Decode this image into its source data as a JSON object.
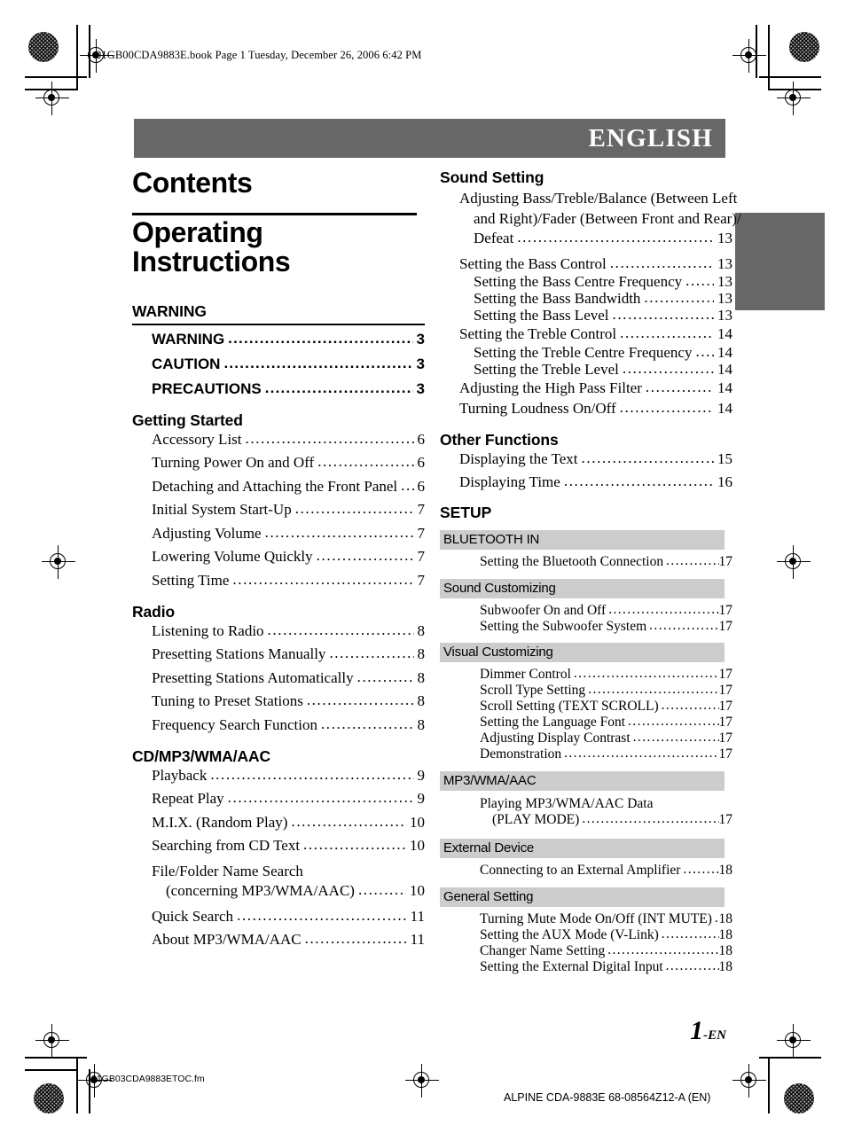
{
  "print_marks": {
    "file_info_line": "01GB00CDA9883E.book  Page 1  Tuesday, December 26, 2006  6:42 PM",
    "footer_filename": "01GB03CDA9883ETOC.fm",
    "footer_model": "ALPINE CDA-9883E 68-08564Z12-A (EN)"
  },
  "banner": {
    "language": "ENGLISH",
    "bar_color": "#676767",
    "text_color": "#ffffff"
  },
  "thumb_tab": {
    "color": "#676767"
  },
  "titles": {
    "contents": "Contents",
    "operating_instructions": "Operating Instructions"
  },
  "page_number": {
    "number": "1",
    "suffix": "-EN"
  },
  "left_column": {
    "sections": [
      {
        "heading": "WARNING",
        "ruled": true,
        "bold_entries": true,
        "entries": [
          {
            "label": "WARNING",
            "page": "3"
          },
          {
            "label": "CAUTION",
            "page": "3"
          },
          {
            "label": "PRECAUTIONS",
            "page": "3"
          }
        ]
      },
      {
        "heading": "Getting Started",
        "ruled": false,
        "bold_entries": false,
        "entries": [
          {
            "label": "Accessory List",
            "page": "6"
          },
          {
            "label": "Turning Power On and Off",
            "page": "6"
          },
          {
            "label": "Detaching and Attaching the Front Panel",
            "page": "6"
          },
          {
            "label": "Initial System Start-Up",
            "page": "7"
          },
          {
            "label": "Adjusting Volume",
            "page": "7"
          },
          {
            "label": "Lowering Volume Quickly",
            "page": "7"
          },
          {
            "label": "Setting Time",
            "page": "7"
          }
        ]
      },
      {
        "heading": "Radio",
        "ruled": false,
        "bold_entries": false,
        "entries": [
          {
            "label": "Listening to Radio",
            "page": "8"
          },
          {
            "label": "Presetting Stations Manually",
            "page": "8"
          },
          {
            "label": "Presetting Stations Automatically",
            "page": "8"
          },
          {
            "label": "Tuning to Preset Stations",
            "page": "8"
          },
          {
            "label": "Frequency Search Function",
            "page": "8"
          }
        ]
      },
      {
        "heading": "CD/MP3/WMA/AAC",
        "ruled": false,
        "bold_entries": false,
        "entries": [
          {
            "label": "Playback",
            "page": "9"
          },
          {
            "label": "Repeat Play",
            "page": "9"
          },
          {
            "label": "M.I.X. (Random Play)",
            "page": "10"
          },
          {
            "label": "Searching from CD Text",
            "page": "10"
          }
        ],
        "wrapped_entry": {
          "line1": "File/Folder Name Search",
          "line2": "(concerning MP3/WMA/AAC)",
          "page": "10"
        },
        "entries_after": [
          {
            "label": "Quick Search",
            "page": "11"
          },
          {
            "label": "About MP3/WMA/AAC",
            "page": "11"
          }
        ]
      }
    ]
  },
  "right_column": {
    "sound_setting": {
      "heading": "Sound Setting",
      "wrapped_entry": {
        "line1": "Adjusting Bass/Treble/Balance (Between Left",
        "line2": "and Right)/Fader (Between Front and Rear)/",
        "line3": "Defeat",
        "page": "13"
      },
      "entries": [
        {
          "label": "Setting the Bass Control",
          "page": "13",
          "sub": false
        },
        {
          "label": "Setting the Bass Centre Frequency",
          "page": "13",
          "sub": true
        },
        {
          "label": "Setting the Bass Bandwidth",
          "page": "13",
          "sub": true
        },
        {
          "label": "Setting the Bass Level",
          "page": "13",
          "sub": true
        },
        {
          "label": "Setting the Treble Control",
          "page": "14",
          "sub": false
        },
        {
          "label": "Setting the Treble Centre Frequency",
          "page": "14",
          "sub": true
        },
        {
          "label": "Setting the Treble Level",
          "page": "14",
          "sub": true
        },
        {
          "label": "Adjusting the High Pass Filter",
          "page": "14",
          "sub": false
        },
        {
          "label": "Turning Loudness On/Off",
          "page": "14",
          "sub": false
        }
      ]
    },
    "other_functions": {
      "heading": "Other Functions",
      "entries": [
        {
          "label": "Displaying the Text",
          "page": "15"
        },
        {
          "label": "Displaying Time",
          "page": "16"
        }
      ]
    },
    "setup": {
      "heading": "SETUP",
      "blocks": [
        {
          "title": "BLUETOOTH IN",
          "entries": [
            {
              "label": "Setting the Bluetooth Connection",
              "page": "17"
            }
          ]
        },
        {
          "title": "Sound Customizing",
          "entries": [
            {
              "label": "Subwoofer On and Off",
              "page": "17"
            },
            {
              "label": "Setting the Subwoofer System",
              "page": "17"
            }
          ]
        },
        {
          "title": "Visual Customizing",
          "entries": [
            {
              "label": "Dimmer Control",
              "page": "17"
            },
            {
              "label": "Scroll Type Setting",
              "page": "17"
            },
            {
              "label": "Scroll Setting (TEXT SCROLL)",
              "page": "17"
            },
            {
              "label": "Setting the Language Font",
              "page": "17"
            },
            {
              "label": "Adjusting Display Contrast",
              "page": "17"
            },
            {
              "label": "Demonstration",
              "page": "17"
            }
          ]
        },
        {
          "title": "MP3/WMA/AAC",
          "wrapped_entry": {
            "line1": "Playing MP3/WMA/AAC Data",
            "line2": "(PLAY MODE)",
            "page": "17"
          },
          "entries": []
        },
        {
          "title": "External Device",
          "entries": [
            {
              "label": "Connecting to an External Amplifier",
              "page": "18"
            }
          ]
        },
        {
          "title": "General Setting",
          "entries": [
            {
              "label": "Turning Mute Mode On/Off (INT MUTE)",
              "page": "18"
            },
            {
              "label": "Setting the AUX Mode (V-Link)",
              "page": "18"
            },
            {
              "label": "Changer Name Setting",
              "page": "18"
            },
            {
              "label": "Setting the External Digital Input",
              "page": "18"
            }
          ]
        }
      ]
    }
  }
}
